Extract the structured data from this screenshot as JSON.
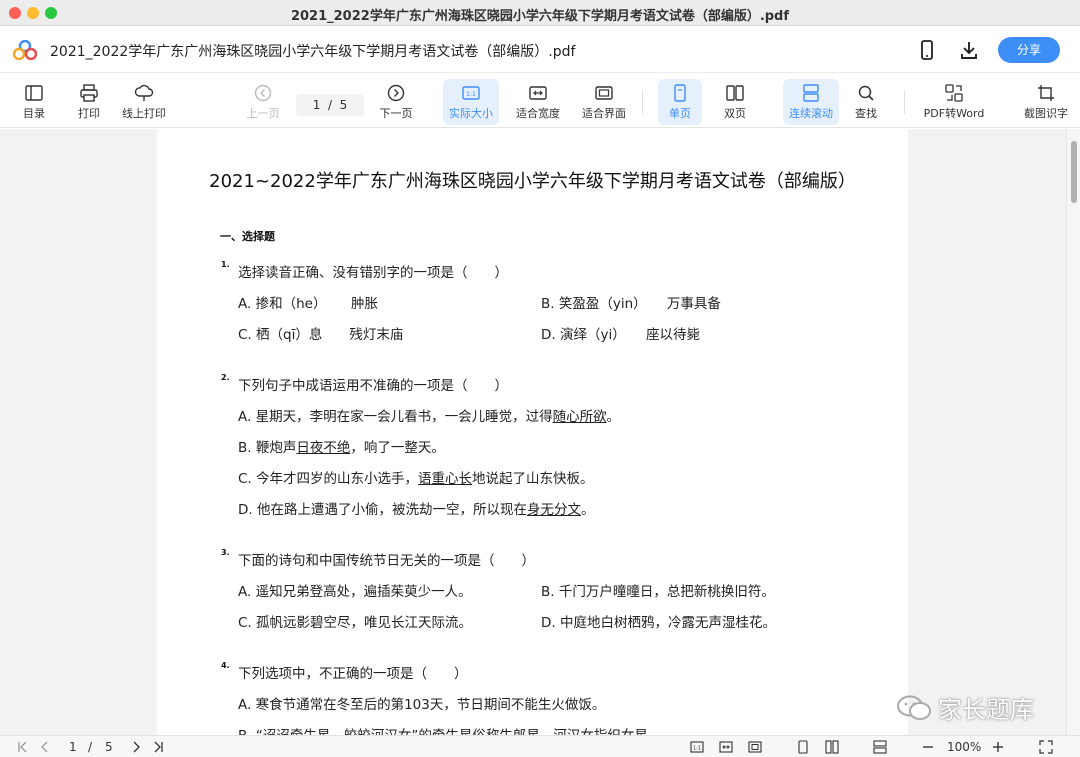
{
  "window": {
    "title": "2021_2022学年广东广州海珠区晓园小学六年级下学期月考语文试卷（部编版）.pdf"
  },
  "appbar": {
    "doc_title": "2021_2022学年广东广州海珠区晓园小学六年级下学期月考语文试卷（部编版）.pdf",
    "share_label": "分享"
  },
  "toolbar": {
    "toc": "目录",
    "print": "打印",
    "online_print": "线上打印",
    "prev_page": "上一页",
    "page_current": "1",
    "page_sep": "/",
    "page_total": "5",
    "next_page": "下一页",
    "actual_size": "实际大小",
    "fit_width": "适合宽度",
    "fit_page": "适合界面",
    "single_page": "单页",
    "double_page": "双页",
    "continuous_scroll": "连续滚动",
    "find": "查找",
    "pdf_to_word": "PDF转Word",
    "ocr": "截图识字"
  },
  "document": {
    "heading": "2021~2022学年广东广州海珠区晓园小学六年级下学期月考语文试卷（部编版）",
    "section": "一、选择题",
    "q1": {
      "num": "1.",
      "text": "选择读音正确、没有错别字的一项是（　　）",
      "a": "A. 掺和（he）　　 肿胀",
      "b": "B. 笑盈盈（yin）　　万事具备",
      "c": "C. 栖（qī）息　　残灯末庙",
      "d": "D. 演绎（yi）　　座以待毙"
    },
    "q2": {
      "num": "2.",
      "text": "下列句子中成语运用不准确的一项是（　　）",
      "a_pre": "A. 星期天，李明在家一会儿看书，一会儿睡觉，过得",
      "a_ul": "随心所欲",
      "a_post": "。",
      "b_pre": "B. 鞭炮声",
      "b_ul": "日夜不绝",
      "b_post": "，响了一整天。",
      "c_pre": "C. 今年才四岁的山东小选手，",
      "c_ul": "语重心长",
      "c_post": "地说起了山东快板。",
      "d_pre": "D. 他在路上遭遇了小偷，被洗劫一空，所以现在",
      "d_ul": "身无分文",
      "d_post": "。"
    },
    "q3": {
      "num": "3.",
      "text": "下面的诗句和中国传统节日无关的一项是（　　）",
      "a": "A. 遥知兄弟登高处，遍插茱萸少一人。",
      "b": "B. 千门万户曈曈日，总把新桃换旧符。",
      "c": "C. 孤帆远影碧空尽，唯见长江天际流。",
      "d": "D. 中庭地白树栖鸦，冷露无声湿桂花。"
    },
    "q4": {
      "num": "4.",
      "text": "下列选项中，不正确的一项是（　　）",
      "a": "A. 寒食节通常在冬至后的第103天，节日期间不能生火做饭。",
      "b": "B. “迢迢牵牛星，皎皎河汉女”的牵牛星俗称牛郎星，河汉女指织女星。"
    }
  },
  "watermark": "家长题库",
  "statusbar": {
    "page_current": "1",
    "page_sep": "/",
    "page_total": "5",
    "zoom": "100%"
  }
}
